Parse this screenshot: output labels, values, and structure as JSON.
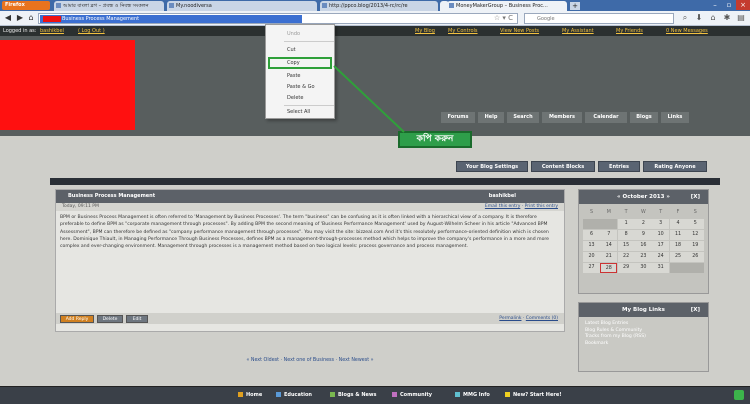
{
  "browser": {
    "app_button": "Firefox",
    "tabs": [
      {
        "label": "আমার বাংলা ব্লগ – প্রবন্ধ ও নিবন্ধ সংকলন",
        "active": false
      },
      {
        "label": "My.noodiversa",
        "active": false
      },
      {
        "label": "http://ppco.blog/2013/4-rc/rc/re",
        "active": false
      },
      {
        "label": "MoneyMakerGroup – Business Proc...",
        "active": true
      }
    ],
    "new_tab": "+",
    "url": "Business Process Management",
    "search_placeholder": "Google",
    "colors": {
      "tab_strip": "#3e6aa8",
      "selection": "#3b6fd1"
    }
  },
  "forumbar": {
    "logged_in": "Logged in as:",
    "username": "bashikbel",
    "logout": "( Log Out )",
    "my_blog": "My Blog",
    "my_controls": "My Controls",
    "view_new_posts": "View New Posts",
    "my_assistant": "My Assistant",
    "my_friends": "My Friends",
    "new_messages": "0 New Messages"
  },
  "context_menu": {
    "items": [
      {
        "label": "Undo",
        "disabled": true
      },
      {
        "label": "Cut",
        "disabled": false
      },
      {
        "label": "Copy",
        "disabled": false
      },
      {
        "label": "Paste",
        "disabled": false
      },
      {
        "label": "Paste & Go",
        "disabled": false
      },
      {
        "label": "Delete",
        "disabled": false
      },
      {
        "label": "Select All",
        "disabled": false
      }
    ]
  },
  "callout": {
    "text": "কপি করুন",
    "color": "#2e9e4a"
  },
  "nav_tabs": [
    "Forums",
    "Help",
    "Search",
    "Members",
    "Calendar",
    "Blogs",
    "Links"
  ],
  "blog_toolbar": [
    "Your Blog Settings",
    "Content Blocks",
    "Entries",
    "Rating Anyone"
  ],
  "post": {
    "title": "Business Process Management",
    "author": "bashikbel",
    "date": "Today, 09:11 PM",
    "email_link": "Email this entry",
    "print_link": "Print this entry",
    "body": "BPM or Business Process Management is often referred to 'Management by Business Processes'. The term \"business\" can be confusing as it is often linked with a hierarchical view of a company. It is therefore preferable to define BPM as \"corporate management through processes\". By adding BPM the second meaning of 'Business Performance Management' used by August-Wilhelm Scheer in his article \"Advanced BPM Assessment\", BPM can therefore be defined as \"company performance management through processes\". You may visit the site: bizzeal.com And it's this resolutely performance-oriented definition which is chosen here. Dominique Thiault, in Managing Performance Through Business Processes, defines BPM as a management-through-processes method which helps to improve the company's performance in a more and more complex and ever-changing environment. Management through processes is a management method based on two logical levels: process governance and process management.",
    "buttons": [
      "Add Reply",
      "Delete",
      "Edit"
    ],
    "permalink": "Permalink",
    "comments": "Comments (0)"
  },
  "pager": "« Next Oldest · Next one of Business · Next Newest »",
  "calendar": {
    "title": "« October 2013 »",
    "close": "[X]",
    "weekdays": [
      "S",
      "M",
      "T",
      "W",
      "T",
      "F",
      "S"
    ],
    "rows": [
      [
        "",
        "",
        "1",
        "2",
        "3",
        "4",
        "5"
      ],
      [
        "6",
        "7",
        "8",
        "9",
        "10",
        "11",
        "12"
      ],
      [
        "13",
        "14",
        "15",
        "16",
        "17",
        "18",
        "19"
      ],
      [
        "20",
        "21",
        "22",
        "23",
        "24",
        "25",
        "26"
      ],
      [
        "27",
        "28",
        "29",
        "30",
        "31",
        "",
        ""
      ]
    ],
    "today": "28"
  },
  "blog_links": {
    "title": "My Blog Links",
    "close": "[X]",
    "items": [
      "Latest Blog Entries",
      "Blog Rules & Community",
      "Tracks from my Blog (RSS)",
      "Bookmark"
    ]
  },
  "bottombar": [
    "Home",
    "Education",
    "Blogs & News",
    "Community",
    "MMG Info",
    "New? Start Here!"
  ]
}
